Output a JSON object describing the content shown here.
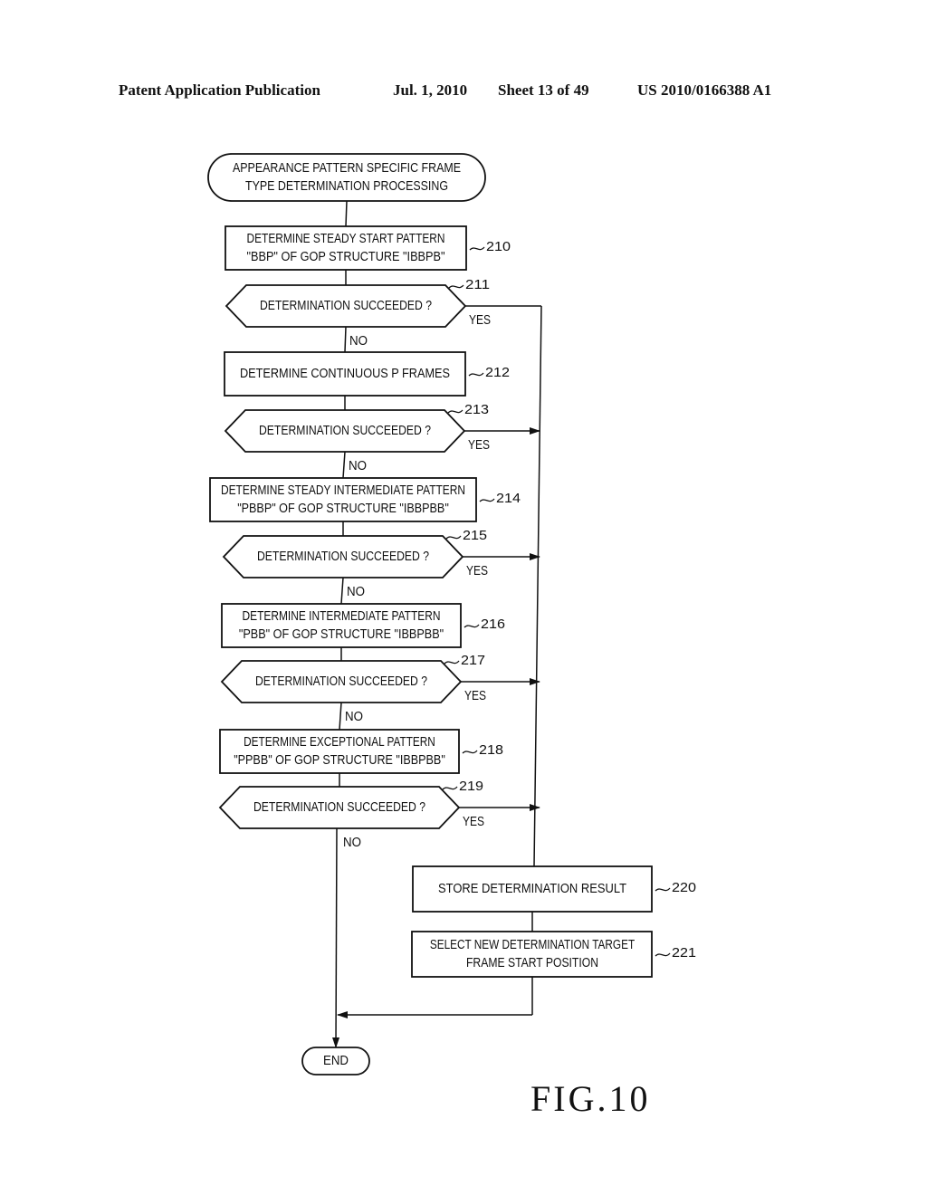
{
  "header": {
    "publication": "Patent Application Publication",
    "date": "Jul. 1, 2010",
    "sheet": "Sheet 13 of 49",
    "number": "US 2010/0166388 A1"
  },
  "figure_label": "FIG.10",
  "flowchart": {
    "start": [
      "APPEARANCE PATTERN SPECIFIC FRAME",
      "TYPE DETERMINATION PROCESSING"
    ],
    "end": "END",
    "yes_label": "YES",
    "no_label": "NO",
    "steps": [
      {
        "ref": "210",
        "type": "process",
        "lines": [
          "DETERMINE STEADY START PATTERN",
          "\"BBP\" OF GOP STRUCTURE \"IBBPB\""
        ]
      },
      {
        "ref": "211",
        "type": "decision",
        "lines": [
          "DETERMINATION SUCCEEDED ?"
        ]
      },
      {
        "ref": "212",
        "type": "process",
        "lines": [
          "DETERMINE CONTINUOUS P FRAMES"
        ]
      },
      {
        "ref": "213",
        "type": "decision",
        "lines": [
          "DETERMINATION SUCCEEDED ?"
        ]
      },
      {
        "ref": "214",
        "type": "process",
        "lines": [
          "DETERMINE STEADY INTERMEDIATE PATTERN",
          "\"PBBP\" OF GOP STRUCTURE \"IBBPBB\""
        ]
      },
      {
        "ref": "215",
        "type": "decision",
        "lines": [
          "DETERMINATION SUCCEEDED ?"
        ]
      },
      {
        "ref": "216",
        "type": "process",
        "lines": [
          "DETERMINE INTERMEDIATE PATTERN",
          "\"PBB\" OF GOP STRUCTURE \"IBBPBB\""
        ]
      },
      {
        "ref": "217",
        "type": "decision",
        "lines": [
          "DETERMINATION SUCCEEDED ?"
        ]
      },
      {
        "ref": "218",
        "type": "process",
        "lines": [
          "DETERMINE EXCEPTIONAL PATTERN",
          "\"PPBB\" OF GOP STRUCTURE \"IBBPBB\""
        ]
      },
      {
        "ref": "219",
        "type": "decision",
        "lines": [
          "DETERMINATION SUCCEEDED ?"
        ]
      },
      {
        "ref": "220",
        "type": "process",
        "lines": [
          "STORE DETERMINATION RESULT"
        ]
      },
      {
        "ref": "221",
        "type": "process",
        "lines": [
          "SELECT NEW DETERMINATION TARGET",
          "FRAME START POSITION"
        ]
      }
    ]
  }
}
